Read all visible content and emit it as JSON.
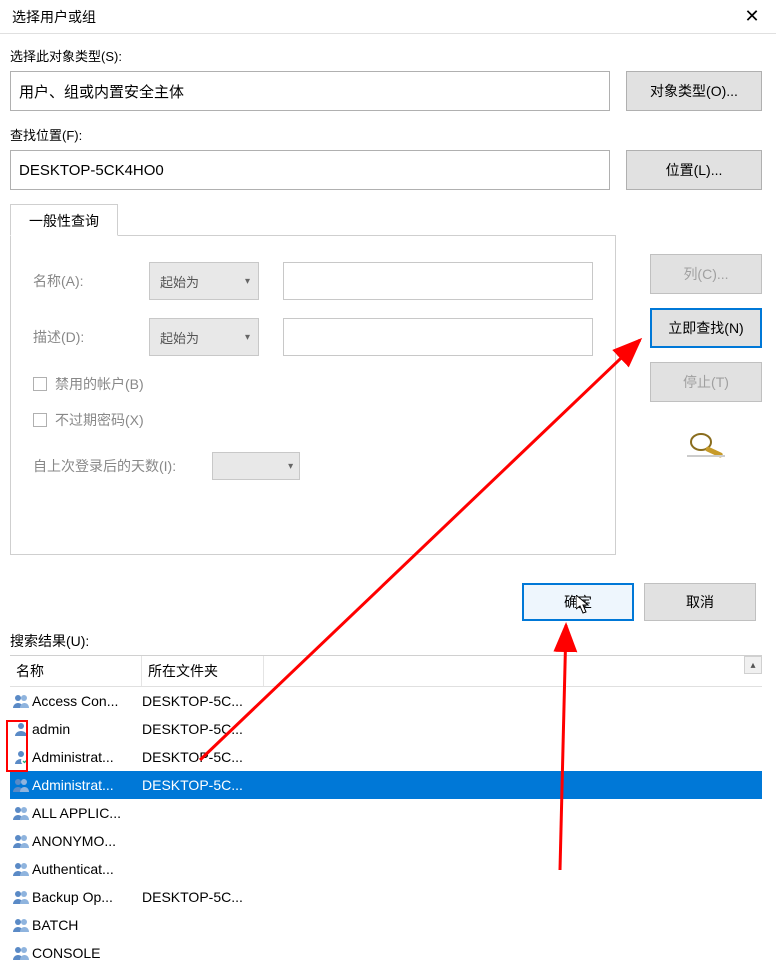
{
  "title": "选择用户或组",
  "section1": {
    "label": "选择此对象类型(S):",
    "value": "用户、组或内置安全主体",
    "button": "对象类型(O)..."
  },
  "section2": {
    "label": "查找位置(F):",
    "value": "DESKTOP-5CK4HO0",
    "button": "位置(L)..."
  },
  "tab_label": "一般性查询",
  "panel": {
    "name_label": "名称(A):",
    "name_mode": "起始为",
    "desc_label": "描述(D):",
    "desc_mode": "起始为",
    "chk_disabled": "禁用的帐户(B)",
    "chk_noexpire": "不过期密码(X)",
    "days_label": "自上次登录后的天数(I):"
  },
  "right": {
    "columns": "列(C)...",
    "findnow": "立即查找(N)",
    "stop": "停止(T)"
  },
  "bottom": {
    "ok": "确定",
    "cancel": "取消"
  },
  "results_label": "搜索结果(U):",
  "headers": {
    "name": "名称",
    "folder": "所在文件夹"
  },
  "rows": [
    {
      "icon": "group",
      "name": "Access Con...",
      "folder": "DESKTOP-5C..."
    },
    {
      "icon": "user",
      "name": "admin",
      "folder": "DESKTOP-5C..."
    },
    {
      "icon": "user-badge",
      "name": "Administrat...",
      "folder": "DESKTOP-5C..."
    },
    {
      "icon": "group",
      "name": "Administrat...",
      "folder": "DESKTOP-5C...",
      "selected": true
    },
    {
      "icon": "group",
      "name": "ALL APPLIC...",
      "folder": ""
    },
    {
      "icon": "group",
      "name": "ANONYMO...",
      "folder": ""
    },
    {
      "icon": "group",
      "name": "Authenticat...",
      "folder": ""
    },
    {
      "icon": "group",
      "name": "Backup Op...",
      "folder": "DESKTOP-5C..."
    },
    {
      "icon": "group",
      "name": "BATCH",
      "folder": ""
    },
    {
      "icon": "group",
      "name": "CONSOLE",
      "folder": ""
    }
  ]
}
